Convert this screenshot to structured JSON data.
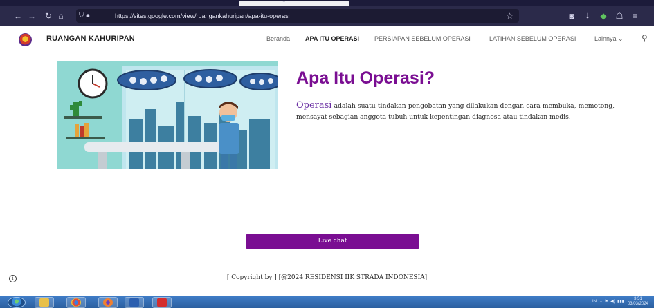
{
  "browser": {
    "tab_title": "...",
    "url": "https://sites.google.com/view/ruangankahuripan/apa-itu-operasi",
    "icons": [
      "back-icon",
      "forward-icon",
      "reload-icon",
      "home-icon",
      "shield-icon",
      "lock-icon",
      "star-icon",
      "pocket-icon",
      "download-icon",
      "extension-icon",
      "account-icon",
      "menu-icon"
    ]
  },
  "site": {
    "title": "RUANGAN KAHURIPAN",
    "nav": [
      {
        "label": "Beranda"
      },
      {
        "label": "APA ITU OPERASI",
        "active": true
      },
      {
        "label": "PERSIAPAN SEBELUM OPERASI"
      },
      {
        "label": "LATIHAN SEBELUM OPERASI"
      },
      {
        "label": "Lainnya ⌄"
      }
    ]
  },
  "content": {
    "heading": "Apa Itu Operasi?",
    "body_highlight": "Operasi",
    "body_rest": " adalah suatu tindakan pengobatan yang dilakukan dengan cara membuka, memotong, mensayat sebagian anggota tubuh untuk kepentingan diagnosa atau tindakan medis.",
    "live_chat_label": "Live chat",
    "footer": "[ Copyright by ]  [@2024 RESIDENSI IIK STRADA INDONESIA]"
  },
  "taskbar": {
    "apps": [
      "file-explorer-icon",
      "chrome-icon",
      "firefox-icon",
      "word-icon",
      "acrobat-icon"
    ],
    "tray_lang": "IN",
    "time": "3:51",
    "date": "03/03/2024"
  },
  "colors": {
    "brand": "#7a0e92",
    "browser_toolbar": "#2b2a4a",
    "taskbar": "#3a74bd"
  }
}
